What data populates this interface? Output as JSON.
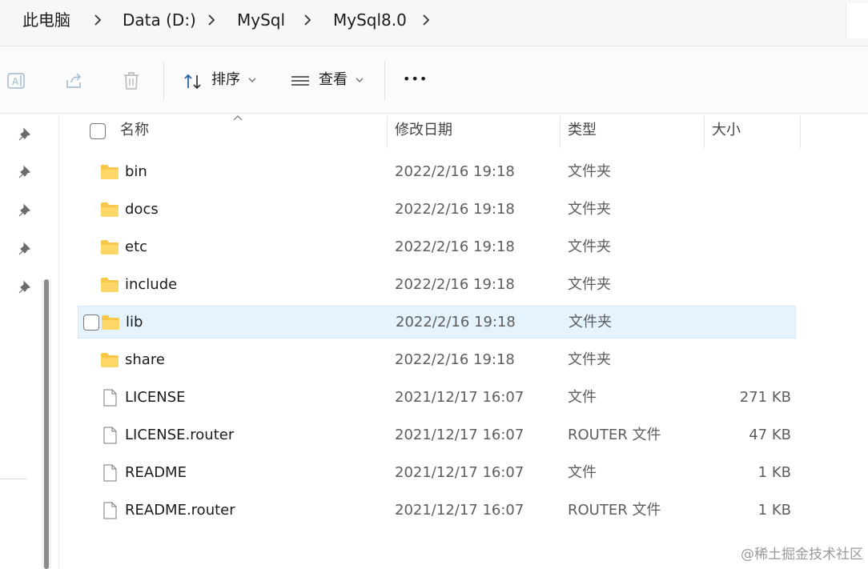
{
  "breadcrumb": {
    "items": [
      "此电脑",
      "Data (D:)",
      "MySql",
      "MySql8.0"
    ]
  },
  "toolbar": {
    "sort_label": "排序",
    "view_label": "查看",
    "more_label": "•••"
  },
  "columns": {
    "name": "名称",
    "date": "修改日期",
    "type": "类型",
    "size": "大小"
  },
  "files": [
    {
      "name": "bin",
      "date": "2022/2/16 19:18",
      "type": "文件夹",
      "size": "",
      "kind": "folder"
    },
    {
      "name": "docs",
      "date": "2022/2/16 19:18",
      "type": "文件夹",
      "size": "",
      "kind": "folder"
    },
    {
      "name": "etc",
      "date": "2022/2/16 19:18",
      "type": "文件夹",
      "size": "",
      "kind": "folder"
    },
    {
      "name": "include",
      "date": "2022/2/16 19:18",
      "type": "文件夹",
      "size": "",
      "kind": "folder"
    },
    {
      "name": "lib",
      "date": "2022/2/16 19:18",
      "type": "文件夹",
      "size": "",
      "kind": "folder",
      "selected": true
    },
    {
      "name": "share",
      "date": "2022/2/16 19:18",
      "type": "文件夹",
      "size": "",
      "kind": "folder"
    },
    {
      "name": "LICENSE",
      "date": "2021/12/17 16:07",
      "type": "文件",
      "size": "271 KB",
      "kind": "file"
    },
    {
      "name": "LICENSE.router",
      "date": "2021/12/17 16:07",
      "type": "ROUTER 文件",
      "size": "47 KB",
      "kind": "file"
    },
    {
      "name": "README",
      "date": "2021/12/17 16:07",
      "type": "文件",
      "size": "1 KB",
      "kind": "file"
    },
    {
      "name": "README.router",
      "date": "2021/12/17 16:07",
      "type": "ROUTER 文件",
      "size": "1 KB",
      "kind": "file"
    }
  ],
  "watermark": "@稀土掘金技术社区",
  "colors": {
    "selection": "#e5f3ff",
    "folder": "#f8c749",
    "accent": "#0067c0"
  }
}
